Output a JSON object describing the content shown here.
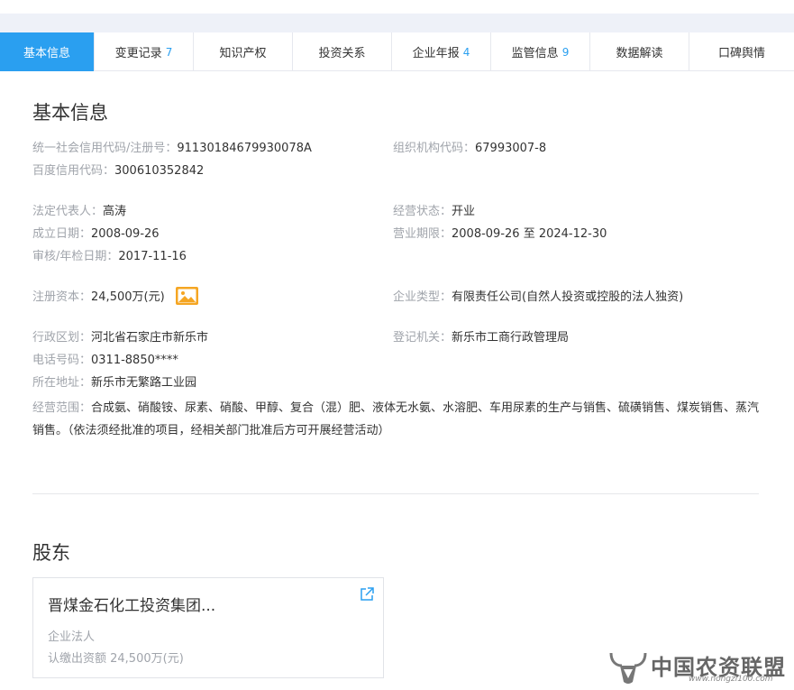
{
  "tabs": [
    {
      "label": "基本信息",
      "count": "",
      "active": true
    },
    {
      "label": "变更记录",
      "count": "7",
      "active": false
    },
    {
      "label": "知识产权",
      "count": "",
      "active": false
    },
    {
      "label": "投资关系",
      "count": "",
      "active": false
    },
    {
      "label": "企业年报",
      "count": "4",
      "active": false
    },
    {
      "label": "监管信息",
      "count": "9",
      "active": false
    },
    {
      "label": "数据解读",
      "count": "",
      "active": false
    },
    {
      "label": "口碑舆情",
      "count": "",
      "active": false
    }
  ],
  "basic": {
    "title": "基本信息",
    "credit_code": {
      "label": "统一社会信用代码/注册号：",
      "value": "91130184679930078A"
    },
    "org_code": {
      "label": "组织机构代码：",
      "value": "67993007-8"
    },
    "baidu_code": {
      "label": "百度信用代码：",
      "value": "300610352842"
    },
    "legal_rep": {
      "label": "法定代表人：",
      "value": "高涛"
    },
    "status": {
      "label": "经营状态：",
      "value": "开业"
    },
    "founded": {
      "label": "成立日期：",
      "value": "2008-09-26"
    },
    "term": {
      "label": "营业期限：",
      "value": "2008-09-26 至 2024-12-30"
    },
    "audit": {
      "label": "审核/年检日期：",
      "value": "2017-11-16"
    },
    "capital": {
      "label": "注册资本：",
      "value": "24,500万(元)"
    },
    "company_type": {
      "label": "企业类型：",
      "value": "有限责任公司(自然人投资或控股的法人独资)"
    },
    "region": {
      "label": "行政区划：",
      "value": "河北省石家庄市新乐市"
    },
    "authority": {
      "label": "登记机关：",
      "value": "新乐市工商行政管理局"
    },
    "phone": {
      "label": "电话号码：",
      "value": "0311-8850****"
    },
    "address": {
      "label": "所在地址：",
      "value": "新乐市无繁路工业园"
    },
    "scope": {
      "label": "经营范围：",
      "value": "合成氨、硝酸铵、尿素、硝酸、甲醇、复合（混）肥、液体无水氨、水溶肥、车用尿素的生产与销售、硫磺销售、煤炭销售、蒸汽销售。（依法须经批准的项目，经相关部门批准后方可开展经营活动）"
    }
  },
  "shareholders": {
    "title": "股东",
    "cards": [
      {
        "name": "晋煤金石化工投资集团...",
        "type": "企业法人",
        "amount": "认缴出资额 24,500万(元)"
      }
    ]
  },
  "watermark": {
    "title": "中国农资联盟",
    "url": "www.nongzi100.com"
  },
  "colors": {
    "accent": "#2a9ff0",
    "label": "#a0a4ab",
    "text": "#333333"
  }
}
